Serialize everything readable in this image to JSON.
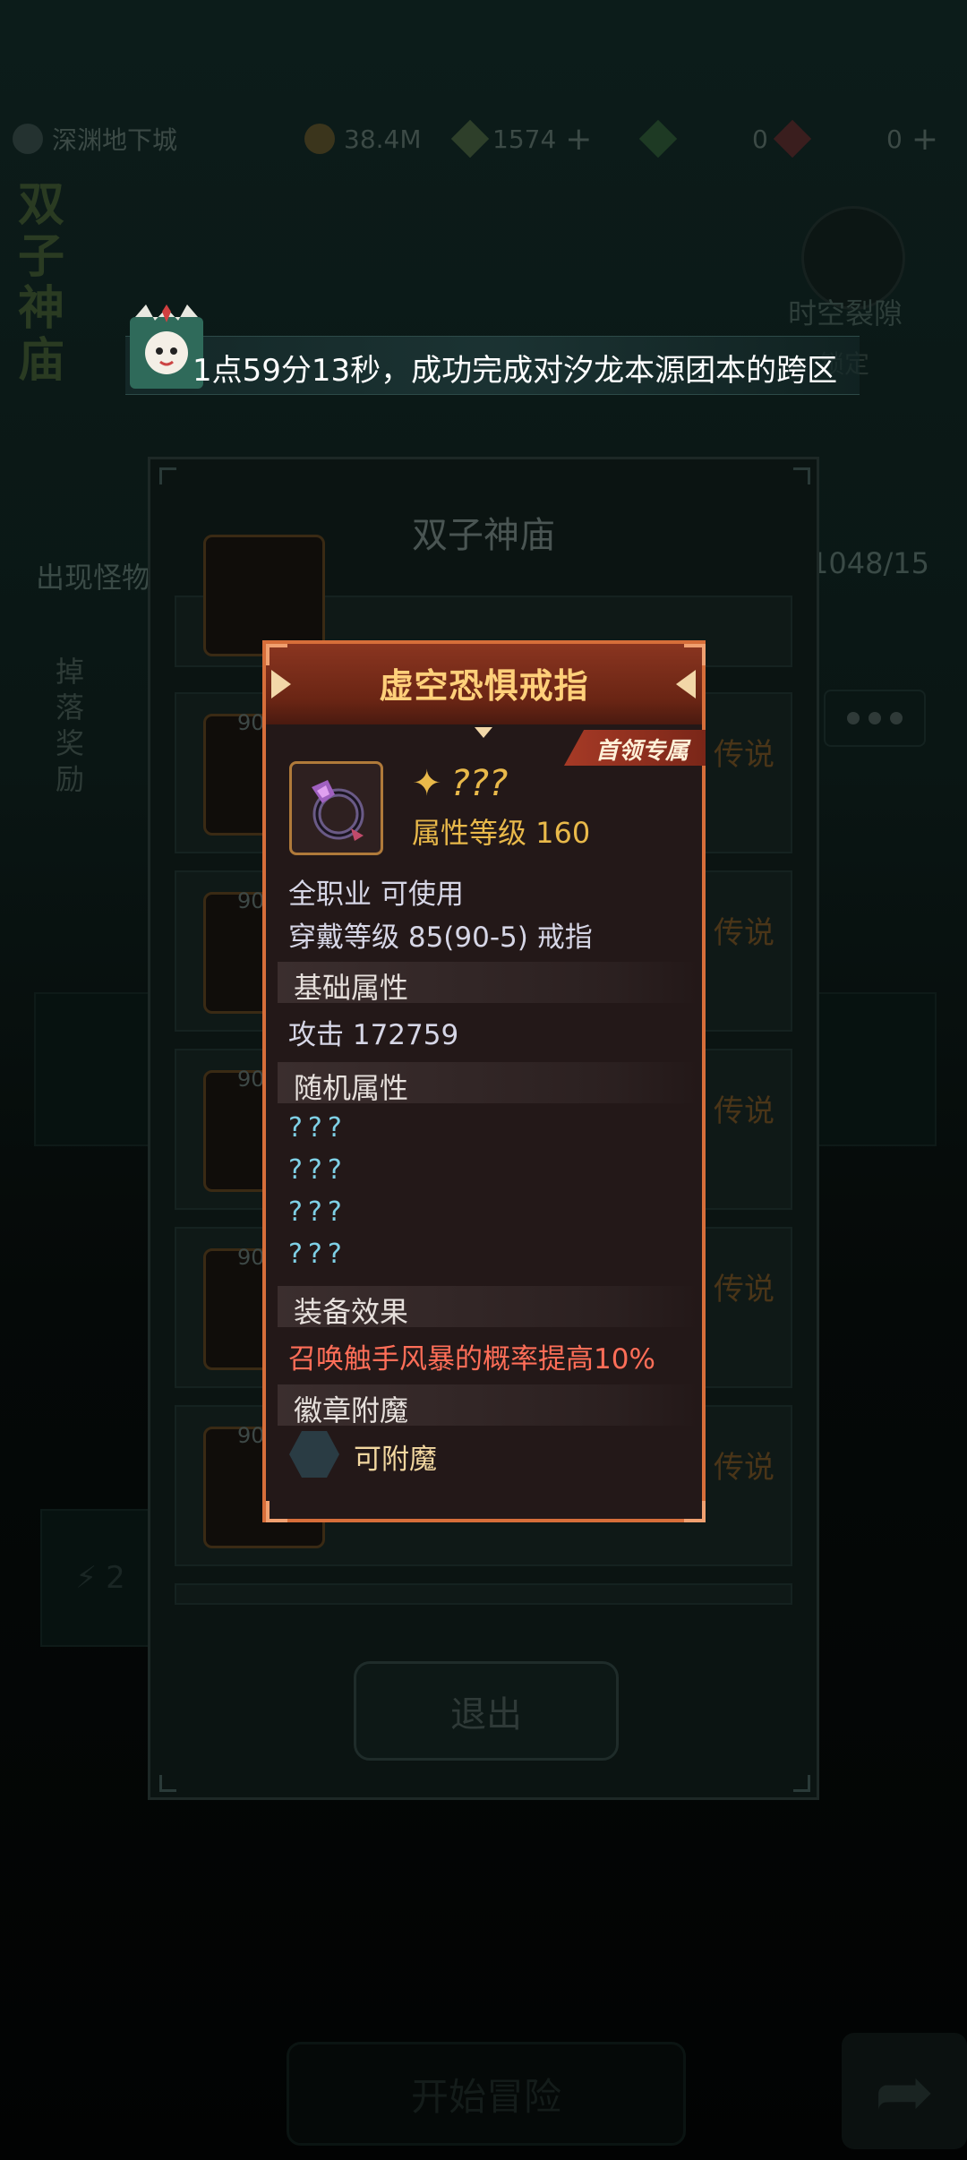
{
  "topbar": {
    "location": "深渊地下城",
    "gold": "38.4M",
    "energy": "1574",
    "gems": "0",
    "tickets": "0"
  },
  "background": {
    "side_title": "双子神庙",
    "rift_label": "时空裂隙",
    "rift_sub": "锁定",
    "monster_label": "出现怪物",
    "monster_count": "1048/15",
    "drop_label": "掉落奖励",
    "start_button": "开始冒险",
    "energy_cost": "2"
  },
  "announcement": {
    "text": "1点59分13秒，成功完成对汐龙本源团本的跨区"
  },
  "dialog": {
    "title": "双子神庙",
    "exit_label": "退出",
    "rows": [
      {
        "level": "90",
        "rarity": "传说"
      },
      {
        "level": "90",
        "rarity": "传说"
      },
      {
        "level": "90",
        "rarity": "传说"
      },
      {
        "level": "90",
        "rarity": "传说"
      },
      {
        "level": "90",
        "rarity": "传说"
      }
    ]
  },
  "tooltip": {
    "title": "虚空恐惧戒指",
    "badge": "首领专属",
    "item_name": "???",
    "attribute_level": "属性等级 160",
    "usable": "全职业 可使用",
    "equip_level": "穿戴等级 85(90-5) 戒指",
    "base_section": "基础属性",
    "attack": "攻击  172759",
    "random_section": "随机属性",
    "random_lines": [
      "???",
      "???",
      "???",
      "???"
    ],
    "effect_section": "装备效果",
    "effect_text": "召唤触手风暴的概率提高10%",
    "badge_section": "徽章附魔",
    "socket_label": "可附魔"
  },
  "colors": {
    "frame_orange": "#d76e3a",
    "gold_text": "#e9b94a",
    "effect_red": "#ff6e58",
    "random_cyan": "#7fd0e6"
  }
}
